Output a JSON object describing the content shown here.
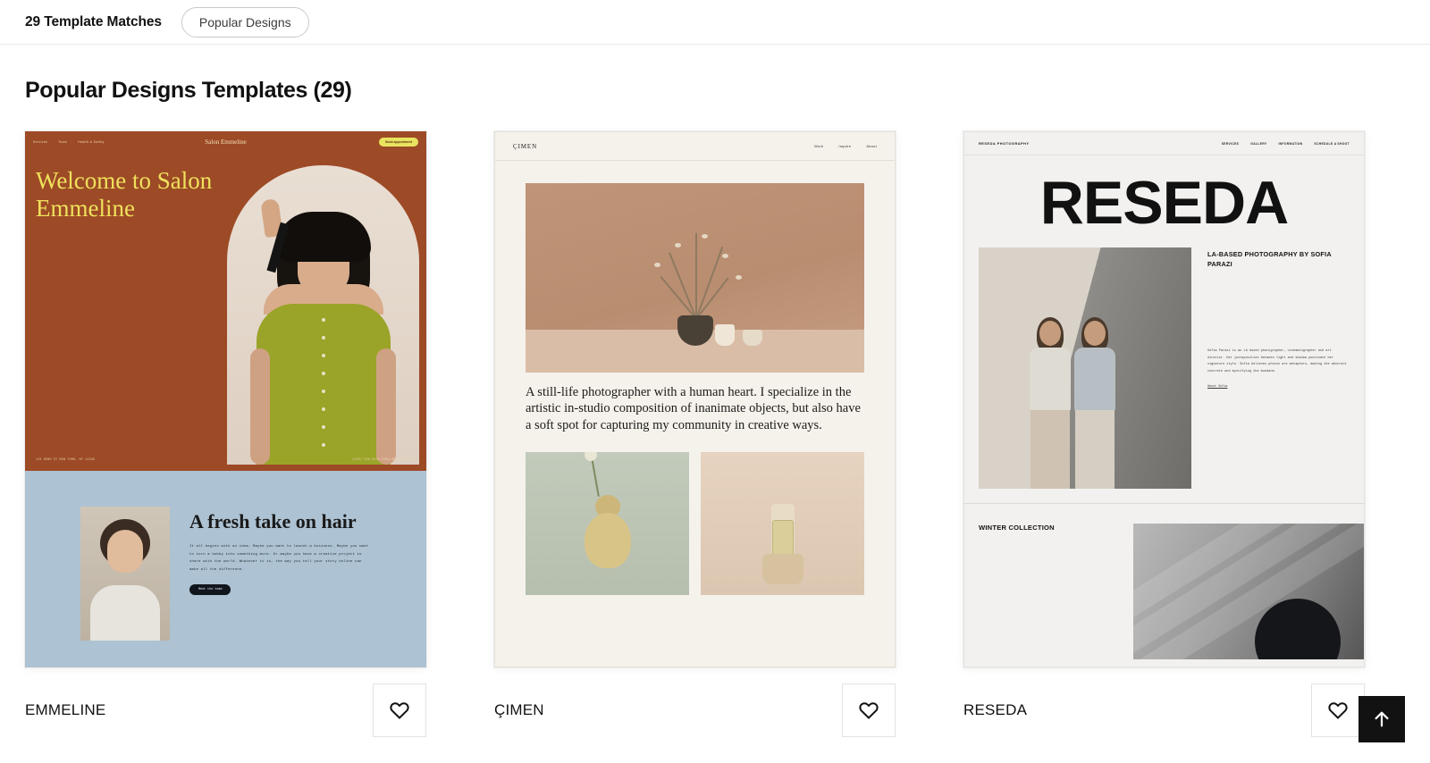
{
  "header": {
    "match_count": "29 Template Matches",
    "filter_label": "Popular Designs"
  },
  "section": {
    "title": "Popular Designs Templates (29)"
  },
  "scroll_to_top": {
    "icon": "arrow-up-icon",
    "label": "Back to top"
  },
  "cards": [
    {
      "name": "EMMELINE",
      "favorite_icon": "heart-outline-icon",
      "preview": {
        "nav_links": [
          "Services",
          "Team",
          "Health & Safety"
        ],
        "brand": "Salon Emmeline",
        "cta": "Book appointment",
        "hero_title": "Welcome to Salon Emmeline",
        "contact_left": "123 DEMO ST\nNEW YORK, NY 12345",
        "contact_right": "(555) 555-5555\nEMAIL@EXAMPLE.COM",
        "section_title": "A fresh take on hair",
        "section_body": "It all begins with an idea. Maybe you want to launch a business. Maybe you want to turn a hobby into something more. Or maybe you have a creative project to share with the world. Whatever it is, the way you tell your story online can make all the difference.",
        "section_button": "Meet the team"
      }
    },
    {
      "name": "ÇIMEN",
      "favorite_icon": "heart-outline-icon",
      "preview": {
        "brand": "ÇIMEN",
        "nav_links": [
          "Work",
          "Inquire",
          "About"
        ],
        "body": "A still-life photographer with a human heart. I specialize in the artistic in-studio composition of inanimate objects, but also have a soft spot for capturing my community in creative ways."
      }
    },
    {
      "name": "RESEDA",
      "favorite_icon": "heart-outline-icon",
      "preview": {
        "brand": "RESEDA PHOTOGRAPHY",
        "nav_links": [
          "SERVICES",
          "GALLERY",
          "INFORMATION",
          "SCHEDULE A SHOOT"
        ],
        "title": "RESEDA",
        "subtitle": "LA-BASED PHOTOGRAPHY BY SOFIA PARAZI",
        "bio": "Sofia Parazi is an LA based photographer, cinematographer and art director. Her juxtaposition between light and shadow punctuate her signature style. Sofia believes photos are metaphors, making the abstract concrete and mystifying the mundane.",
        "bio_link": "About Sofia",
        "collection_label": "WINTER COLLECTION"
      }
    }
  ],
  "colors": {
    "emmeline_bg": "#9d4a26",
    "emmeline_accent": "#efe15c",
    "emmeline_lower": "#adc2d2",
    "cimen_bg": "#f5f2ec",
    "reseda_bg": "#f2f1ef",
    "to_top_bg": "#121212"
  }
}
